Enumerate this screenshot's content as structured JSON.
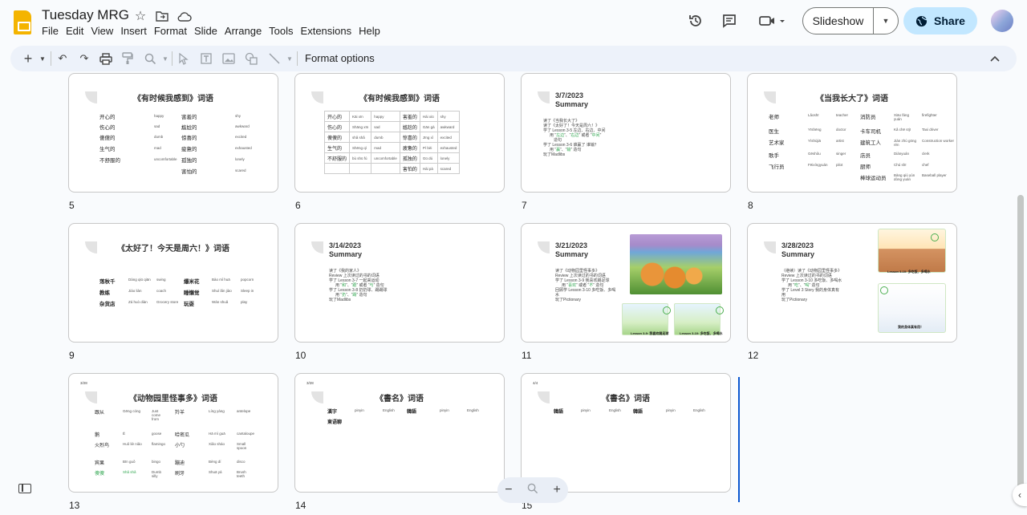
{
  "doc": {
    "title": "Tuesday MRG"
  },
  "menu": [
    "File",
    "Edit",
    "View",
    "Insert",
    "Format",
    "Slide",
    "Arrange",
    "Tools",
    "Extensions",
    "Help"
  ],
  "header": {
    "slideshow_label": "Slideshow",
    "share_label": "Share"
  },
  "toolbar": {
    "format_options_label": "Format options"
  },
  "slides": {
    "s5": {
      "number": "5",
      "title": "《有时候我感到》词语",
      "left": [
        "开心的",
        "伤心的",
        "傻傻的",
        "生气的",
        "不舒服的"
      ],
      "left_py": [
        "happy",
        "sad",
        "dumb",
        "mad",
        "uncomfortable"
      ],
      "right": [
        "害羞的",
        "尴尬的",
        "惊喜的",
        "疲惫的",
        "孤独的",
        "害怕的"
      ],
      "right_py": [
        "shy",
        "awkward",
        "excited",
        "exhausted",
        "lonely",
        "scared"
      ]
    },
    "s6": {
      "number": "6",
      "title": "《有时候我感到》词语",
      "rows": [
        [
          "开心的",
          "Kāi xīn",
          "happy",
          "害羞的",
          "Hài xiū",
          "shy"
        ],
        [
          "伤心的",
          "Shāng xīn",
          "sad",
          "尴尬的",
          "Gān gà",
          "awkward"
        ],
        [
          "傻傻的",
          "shǎ shǎ",
          "dumb",
          "惊喜的",
          "Jīng xǐ",
          "excited"
        ],
        [
          "生气的",
          "Shēng qì",
          "mad",
          "疲惫的",
          "Pí bèi",
          "exhausted"
        ],
        [
          "不舒服的",
          "bù shū fú",
          "uncomfortable",
          "孤独的",
          "Gū dú",
          "lonely"
        ],
        [
          "",
          "",
          "",
          "害怕的",
          "Hài pà",
          "scared"
        ]
      ]
    },
    "s7": {
      "number": "7",
      "date": "3/7/2023",
      "label": "Summary",
      "l1": "读了《当我长大了》",
      "l2": "读了《太好了！今天是周六！》",
      "l3": "学了 Lesson 3-5 左边、右边、中间",
      "l4a": "用 “",
      "l4b": "左边",
      "l4c": "”、“",
      "l4d": "右边",
      "l4e": "” 或者 “",
      "l4f": "中间",
      "l4g": "”",
      "l5": "造句",
      "l6": "学了 Lesson 3-6 谁赢了 谁输？",
      "l7a": "用 “",
      "l7b": "赢",
      "l7c": "”、“",
      "l7d": "输",
      "l7e": "” 造句",
      "l8": "玩了Madlibs"
    },
    "s8": {
      "number": "8",
      "title": "《当我长大了》词语",
      "c1": [
        "老师",
        "医生",
        "艺术家",
        "歌手",
        "飞行员"
      ],
      "c2": [
        "Lǎoshī",
        "Yīshēng",
        "Yìshùjiā",
        "Gēshǒu",
        "Fēixíngyuán"
      ],
      "c3": [
        "teacher",
        "doctor",
        "artist",
        "singer",
        "pilot"
      ],
      "c4": [
        "消防员",
        "卡车司机",
        "建筑工人",
        "店员",
        "厨师",
        "棒球运动员"
      ],
      "c5": [
        "Xiāo fáng yuán",
        "Kǎ chē sījī",
        "Jiàn zhù gōng rén",
        "Diànyuán",
        "Chú shī",
        "Bàng qiú yùn dòng yuán"
      ],
      "c6": [
        "firefighter",
        "Taxi driver",
        "Construction worker",
        "clerk",
        "chef",
        "Baseball player"
      ]
    },
    "s9": {
      "number": "9",
      "title": "《太好了！今天是周六！》词语",
      "l": [
        "荡秋千",
        "教练",
        "杂货店"
      ],
      "lp": [
        "Dàng qiū qiān",
        "Jiào liàn",
        "Zá huò diàn"
      ],
      "le": [
        "swing",
        "coach",
        "Grocery store"
      ],
      "r": [
        "爆米花",
        "睡懒觉",
        "玩耍"
      ],
      "rp": [
        "Bào mǐ huā",
        "Shuì lǎn jiào",
        "Wán shuǎ"
      ],
      "re": [
        "popcorn",
        "Sleep in",
        "play"
      ]
    },
    "s10": {
      "number": "10",
      "date": "3/14/2023",
      "label": "Summary",
      "l1": "读了《我的家人》",
      "l2": "Review 上次读过的书的词语",
      "l3": "学了 Lesson 3-7 一起来运动",
      "l4a": "用 “",
      "l4b": "和",
      "l4c": "”、“",
      "l4d": "跟",
      "l4e": "” 或者 “",
      "l4f": "与",
      "l4g": "” 造句",
      "l5": "学了 Lesson 3-8 扔扔球、踢踢球",
      "l6a": "用 “",
      "l6b": "扔",
      "l6c": "”、“",
      "l6d": "踢",
      "l6e": "” 造句",
      "l7": "玩了Madlibs"
    },
    "s11": {
      "number": "11",
      "date": "3/21/2023",
      "label": "Summary",
      "l1": "读了《动物园里怪事多》",
      "l2": "Review 上次读过的书的词语",
      "l3": "学了 Lesson 3-9 我喜欢踢足球",
      "l4a": "用 “",
      "l4b": "喜欢",
      "l4c": "” 或者 “",
      "l4d": "不",
      "l4e": "” 造句",
      "l5": "回顾学 Lesson 3-10 多吃饭、多喝",
      "l6": "水",
      "l7": "玩了Pictionary",
      "cap1": "Lesson 3-9: 我喜欢踢足球",
      "cap2": "Lesson 3-10: 多吃饭、多喝水"
    },
    "s12": {
      "number": "12",
      "date": "3/28/2023",
      "label": "Summary",
      "l1": "（继续）读了《动物园里怪事多》",
      "l2": "Review 上次读过的书的词语",
      "l3": "学了 Lesson 3-10 多吃饭、多喝水",
      "l4a": "用 “",
      "l4b": "吃",
      "l4c": "”、“",
      "l4d": "喝",
      "l4e": "” 造句",
      "l5": "学了 Level 3 Story 我的身体真有",
      "l6": "用",
      "l7": "玩了Pictionary",
      "cap1": "Lesson 3-10: 多吃饭、多喝水",
      "cap2": "我的身体真有用！"
    },
    "s13": {
      "number": "13",
      "date": "3/28",
      "title": "《动物园里怪事多》词语",
      "rows": [
        {
          "h": "跟从",
          "p": "Gēng cóng",
          "e": "Just come from",
          "h2": "羚羊",
          "p2": "Líng yáng",
          "e2": "antelope"
        },
        {
          "h": "鹅",
          "p": "Ē",
          "e": "goose",
          "h2": "哈密瓜",
          "p2": "Hā mì guā",
          "e2": "cantaloupe"
        },
        {
          "h": "火烈鸟",
          "p": "Huǒ liè niǎo",
          "e": "flamingo",
          "h2": "小勺",
          "p2": "Xiǎo sháo",
          "e2": "Small spoon"
        },
        {
          "h": "宾果",
          "p": "Bīn guǒ",
          "e": "bingo",
          "h2": "蹦迪",
          "p2": "Bèng dí",
          "e2": "disco"
        },
        {
          "h": "傻傻",
          "p": "Shǎ shǎ",
          "e": "Dumb silly",
          "h2": "刷牙",
          "p2": "Shuā yá",
          "e2": "Brush teeth"
        }
      ]
    },
    "s14": {
      "number": "14",
      "date": "3/28",
      "title": "《書名》词语",
      "r1": [
        "漢字",
        "pinyin",
        "English",
        "韓語",
        "pinyin",
        "English"
      ],
      "r2": [
        "東语聊"
      ]
    },
    "s15": {
      "number": "15",
      "date": "4/4",
      "title": "《書名》词语",
      "r1": [
        "韓語",
        "pinyin",
        "English",
        "韓語",
        "pinyin",
        "English"
      ]
    }
  }
}
